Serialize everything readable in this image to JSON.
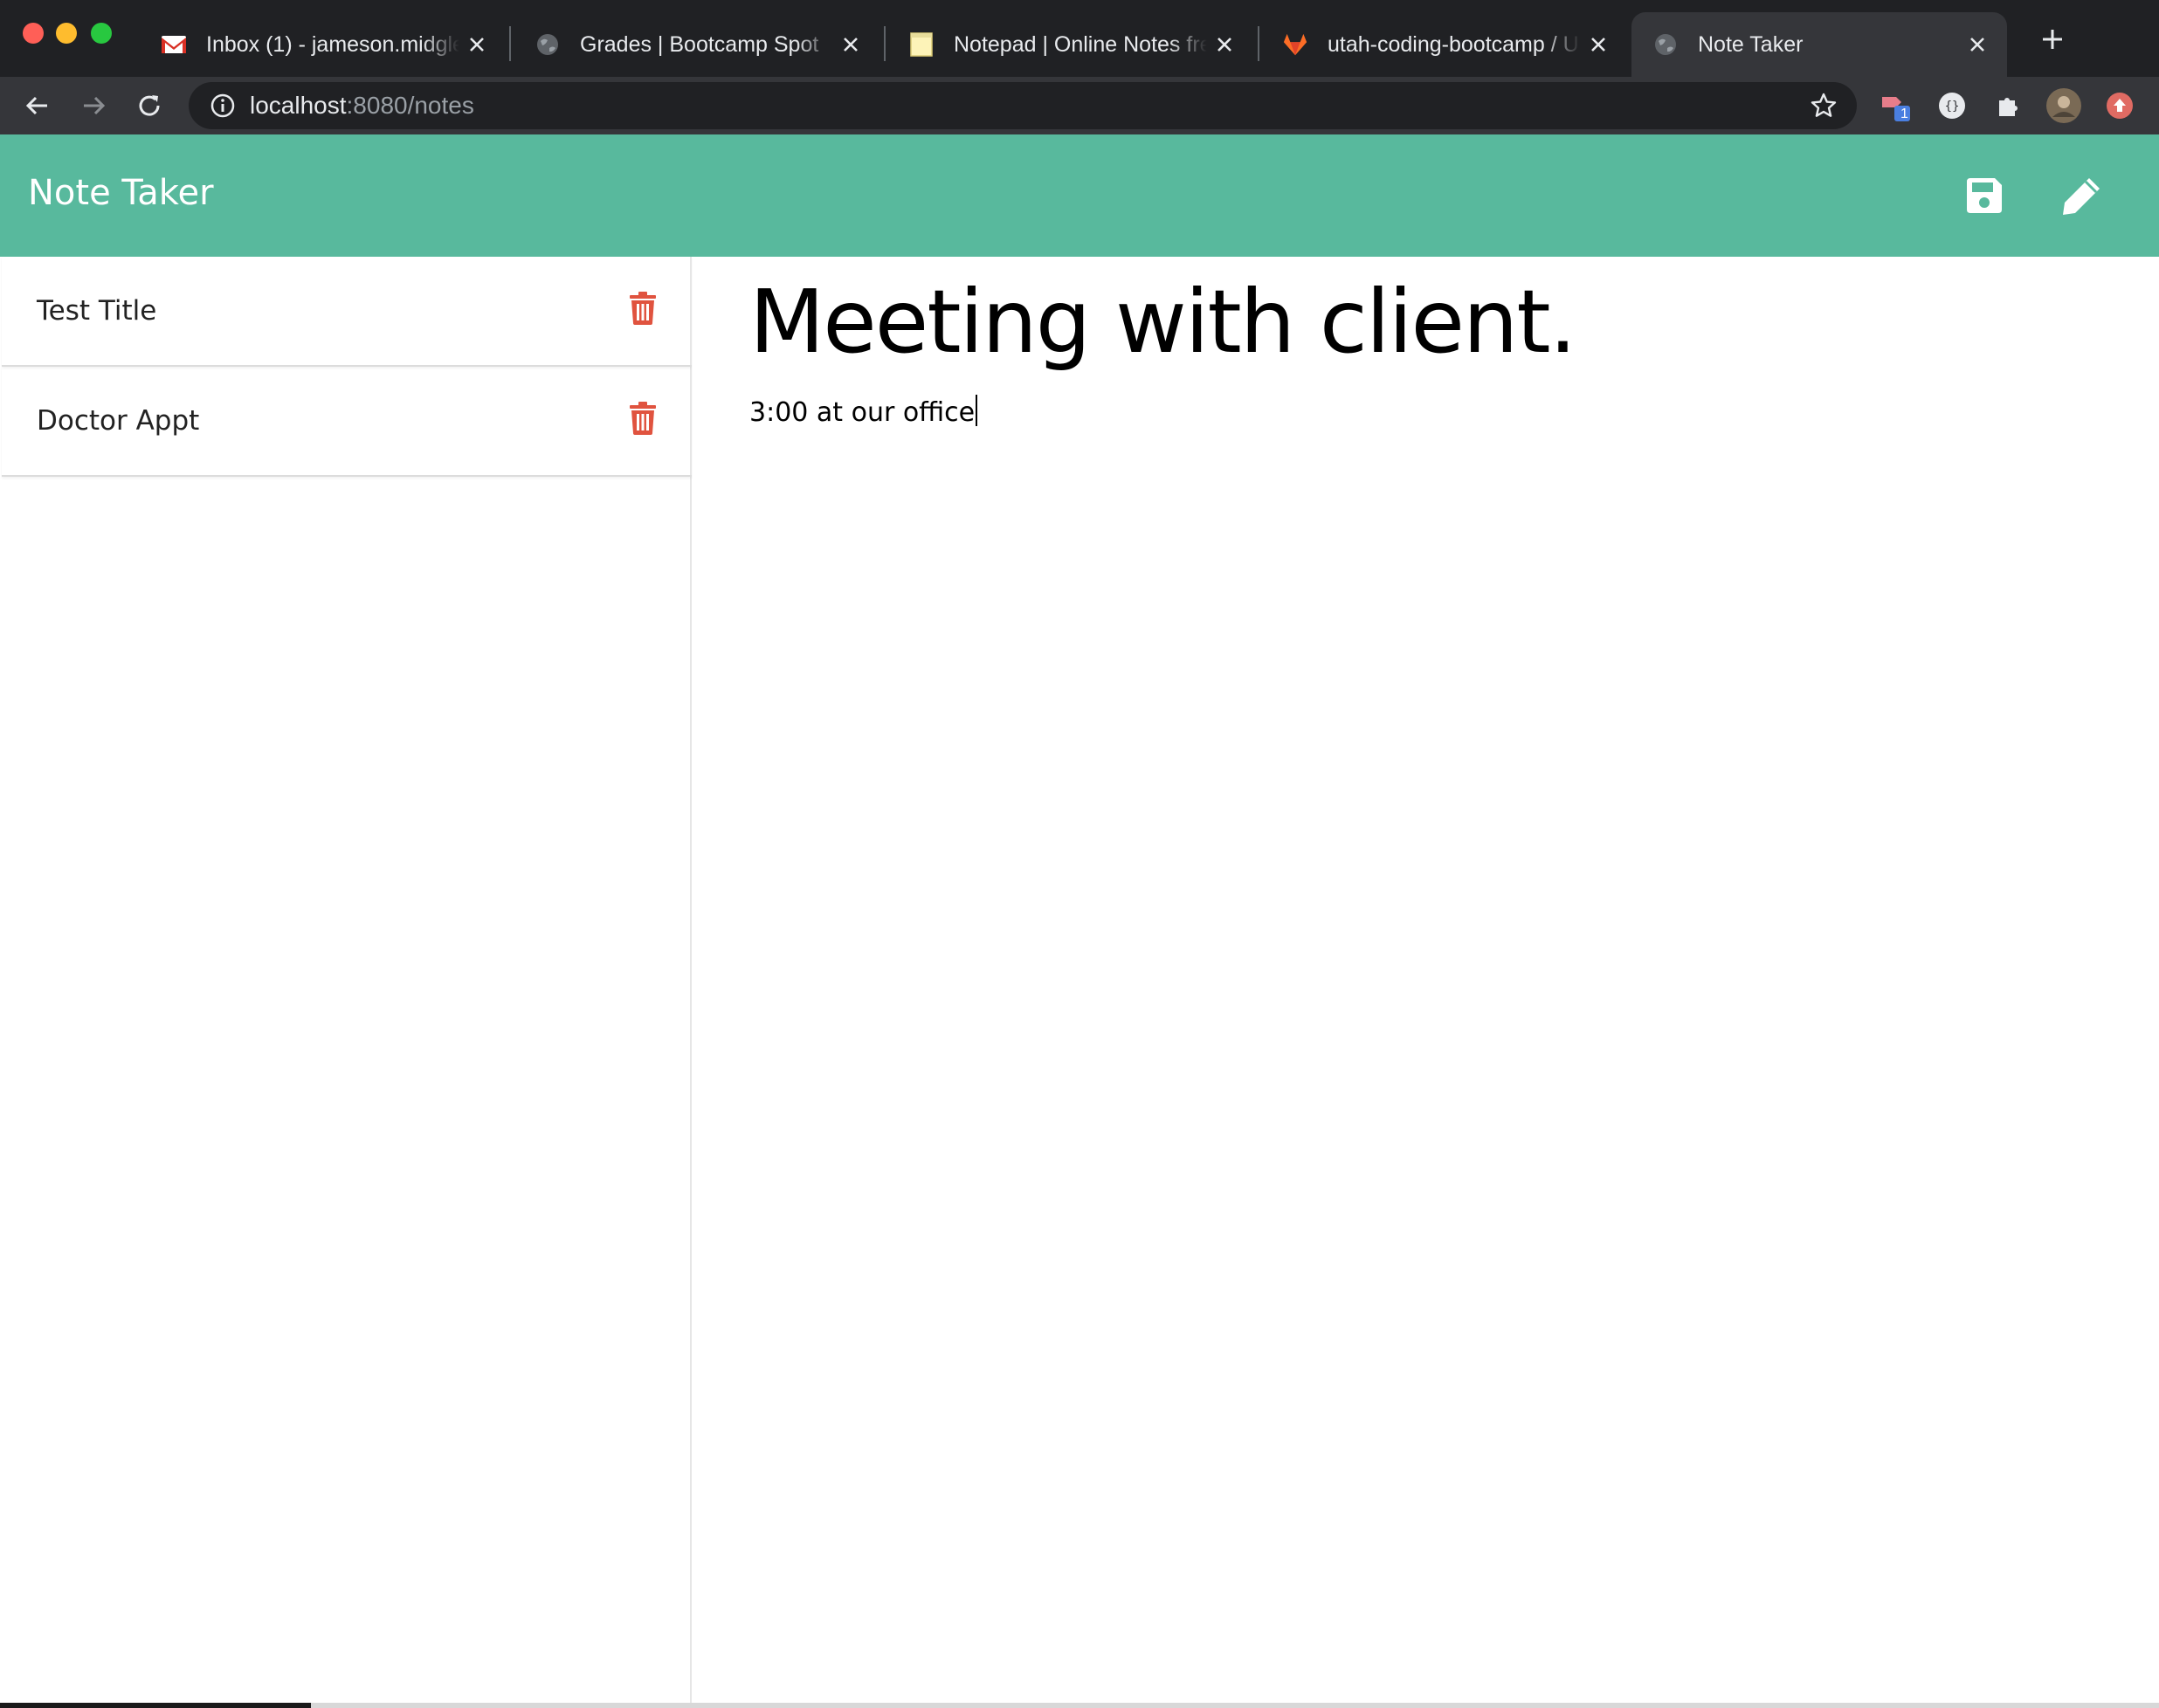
{
  "browser": {
    "tabs": [
      {
        "label": "Inbox (1) - jameson.midgley",
        "favicon": "gmail-icon",
        "active": false
      },
      {
        "label": "Grades | Bootcamp Spot",
        "favicon": "globe-icon",
        "active": false
      },
      {
        "label": "Notepad | Online Notes free",
        "favicon": "notepad-icon",
        "active": false
      },
      {
        "label": "utah-coding-bootcamp / U",
        "favicon": "gitlab-icon",
        "active": false
      },
      {
        "label": "Note Taker",
        "favicon": "globe-icon",
        "active": true
      }
    ],
    "address": {
      "host": "localhost",
      "rest": ":8080/notes"
    },
    "extension_badge": "1",
    "colors": {
      "tabbar": "#202124",
      "toolbar": "#35363a"
    }
  },
  "app": {
    "title": "Note Taker",
    "header_color": "#58b99d",
    "icons": {
      "save": "save-icon",
      "new_note": "pencil-icon",
      "delete": "trash-icon"
    },
    "trash_color": "#e0533f",
    "notes": [
      {
        "title": "Test Title"
      },
      {
        "title": "Doctor Appt"
      }
    ],
    "active_note": {
      "title": "Meeting with client.",
      "text": "3:00 at our office"
    }
  }
}
